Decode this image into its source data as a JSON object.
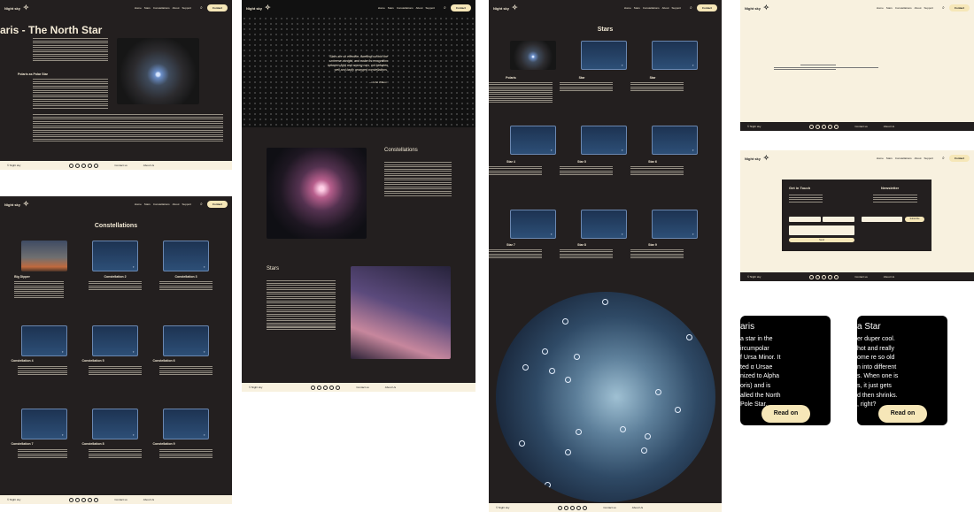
{
  "nav": {
    "brand": "Night sky",
    "links": [
      "Home",
      "Stars",
      "Constellations",
      "About",
      "Support"
    ],
    "contact": "Contact"
  },
  "footer": {
    "tagline": "© Night sky",
    "links": [
      "Contact us",
      "About Us"
    ],
    "icons": [
      "facebook-icon",
      "instagram-icon",
      "linkedin-icon",
      "email-icon",
      "phone-icon"
    ]
  },
  "polaris_page": {
    "title": "aris - The North Star",
    "section": "Polaris as Polar Star"
  },
  "constellations_page": {
    "heading": "Constellations",
    "cards": [
      "Big Dipper",
      "Constellation 2",
      "Constellation 3",
      "Constellation 4",
      "Constellation 5",
      "Constellation 6",
      "Constellation 7",
      "Constellation 8",
      "Constellation 9"
    ]
  },
  "home_page": {
    "quote": "Stars are so effective, dwelling out into the\nuniverse at night, and make its recognition\nbetween light and among cars, not between\nwell and badly arranged constellations.",
    "quote_author": "— John Wilson",
    "section1": "Constellations",
    "section2": "Stars"
  },
  "stars_page": {
    "heading": "Stars",
    "cards": [
      "Polaris",
      "Star",
      "Star",
      "Star 4",
      "Star 5",
      "Star 6",
      "Star 7",
      "Star 8",
      "Star 9"
    ]
  },
  "contact_page": {
    "get_in_touch": "Get in Touch",
    "newsletter": "Newsletter",
    "send": "Send",
    "subscribe": "Subscribe"
  },
  "mobile_cards": [
    {
      "title": "aris",
      "body": "a star in the\nircumpolar\nf Ursa Minor. It\nted α Ursae\nnized to Alpha\noris) and is\nalled the North\nPole Star.",
      "button": "Read on"
    },
    {
      "title": "a Star",
      "body": "er duper cool.\nhot and really\nome re so old\nn into different\ns. When one is\ns, it just gets\nd then shrinks.\n, right?",
      "button": "Read on"
    }
  ]
}
